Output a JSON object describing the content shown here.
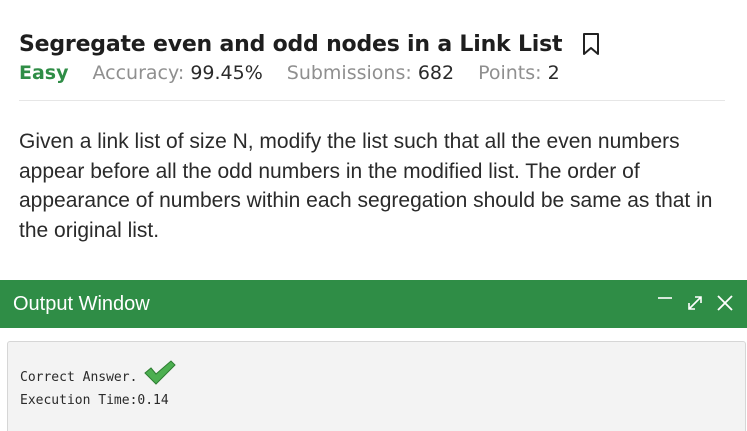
{
  "problem": {
    "title": "Segregate even and odd nodes in a Link List",
    "difficulty": "Easy",
    "accuracy_label": "Accuracy:",
    "accuracy_value": "99.45%",
    "submissions_label": "Submissions:",
    "submissions_value": "682",
    "points_label": "Points:",
    "points_value": "2",
    "description": "Given a link list of size N, modify the list such that all the even numbers appear before all the odd numbers in the modified list. The order of appearance of numbers within each segregation should be same as that in the original list."
  },
  "output_window": {
    "title": "Output Window",
    "result_text": "Correct Answer.",
    "execution_time": "Execution Time:0.14"
  },
  "colors": {
    "accent_green": "#2f8d46",
    "check_green": "#4caf50"
  },
  "icons": {
    "bookmark": "bookmark-icon",
    "minimize": "minimize-icon",
    "expand": "expand-icon",
    "close": "close-icon",
    "check": "check-icon"
  }
}
